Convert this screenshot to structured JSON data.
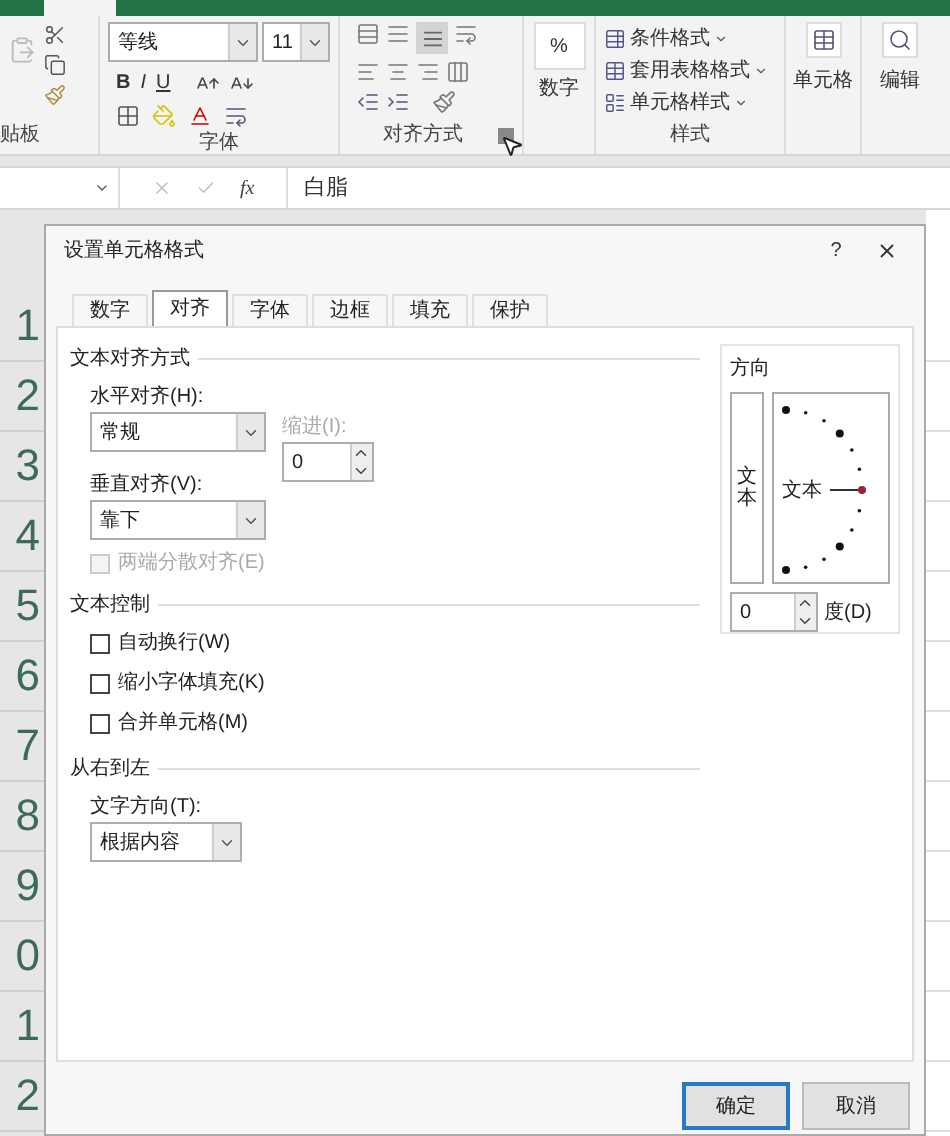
{
  "ribbon": {
    "font_name": "等线",
    "font_size": "11",
    "format_buttons": [
      "B",
      "I",
      "U"
    ],
    "number_symbol": "%",
    "number_button": "数字",
    "style_buttons": [
      "条件格式",
      "套用表格格式",
      "单元格样式"
    ],
    "cells_button": "单元格",
    "edit_button": "编辑",
    "groups": [
      {
        "label": "贴板"
      },
      {
        "label": "字体"
      },
      {
        "label": "对齐方式"
      },
      {
        "label": "样式"
      }
    ]
  },
  "formula_bar": {
    "fx": "fx",
    "value": "白脂"
  },
  "row_headers": [
    "1",
    "2",
    "3",
    "4",
    "5",
    "6",
    "7",
    "8",
    "9",
    "0",
    "1",
    "2"
  ],
  "dialog": {
    "title": "设置单元格格式",
    "help": "?",
    "tabs": [
      {
        "label": "数字",
        "selected": false
      },
      {
        "label": "对齐",
        "selected": true
      },
      {
        "label": "字体",
        "selected": false
      },
      {
        "label": "边框",
        "selected": false
      },
      {
        "label": "填充",
        "selected": false
      },
      {
        "label": "保护",
        "selected": false
      }
    ],
    "alignment": {
      "section": "文本对齐方式",
      "horizontal_label": "水平对齐(H):",
      "horizontal_value": "常规",
      "indent_label": "缩进(I):",
      "indent_disabled": true,
      "indent_value": "0",
      "vertical_label": "垂直对齐(V):",
      "vertical_value": "靠下",
      "distributed": {
        "label": "两端分散对齐(E)",
        "checked": false,
        "disabled": true
      }
    },
    "text_control": {
      "section": "文本控制",
      "options": [
        {
          "label": "自动换行(W)",
          "checked": false
        },
        {
          "label": "缩小字体填充(K)",
          "checked": false
        },
        {
          "label": "合并单元格(M)",
          "checked": false
        }
      ]
    },
    "rtl": {
      "section": "从右到左",
      "direction_label": "文字方向(T):",
      "direction_value": "根据内容"
    },
    "orientation": {
      "section": "方向",
      "vertical_text": "文本",
      "dial_text": "文本",
      "degrees": "0",
      "degree_label": "度(D)"
    },
    "buttons": [
      {
        "label": "确定",
        "default": true
      },
      {
        "label": "取消",
        "default": false
      }
    ]
  }
}
